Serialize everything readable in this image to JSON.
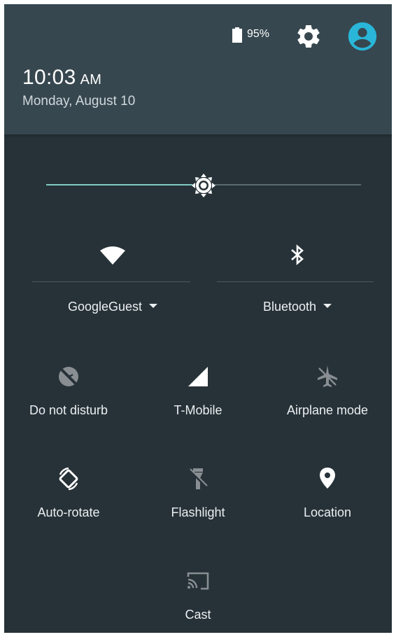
{
  "status": {
    "time": "10:03",
    "ampm": "AM",
    "date": "Monday, August 10",
    "battery_percent": "95%",
    "battery_level": 0.95
  },
  "header": {
    "settings_icon": "gear-icon",
    "account_icon": "account-circle-icon",
    "account_color": "#29b6d9"
  },
  "brightness": {
    "level": 0.5,
    "accent_color": "#80cbc4",
    "icon": "brightness-icon"
  },
  "quick_settings": {
    "wifi": {
      "label": "GoogleGuest",
      "icon": "wifi-icon",
      "state": "on"
    },
    "bluetooth": {
      "label": "Bluetooth",
      "icon": "bluetooth-icon",
      "state": "on"
    },
    "tiles": [
      {
        "label": "Do not disturb",
        "icon": "do-not-disturb-icon",
        "state": "off"
      },
      {
        "label": "T-Mobile",
        "icon": "cell-signal-icon",
        "state": "on"
      },
      {
        "label": "Airplane mode",
        "icon": "airplane-icon",
        "state": "off"
      },
      {
        "label": "Auto-rotate",
        "icon": "auto-rotate-icon",
        "state": "on"
      },
      {
        "label": "Flashlight",
        "icon": "flashlight-icon",
        "state": "off"
      },
      {
        "label": "Location",
        "icon": "location-icon",
        "state": "on"
      },
      {
        "label": "Cast",
        "icon": "cast-icon",
        "state": "off"
      }
    ]
  }
}
